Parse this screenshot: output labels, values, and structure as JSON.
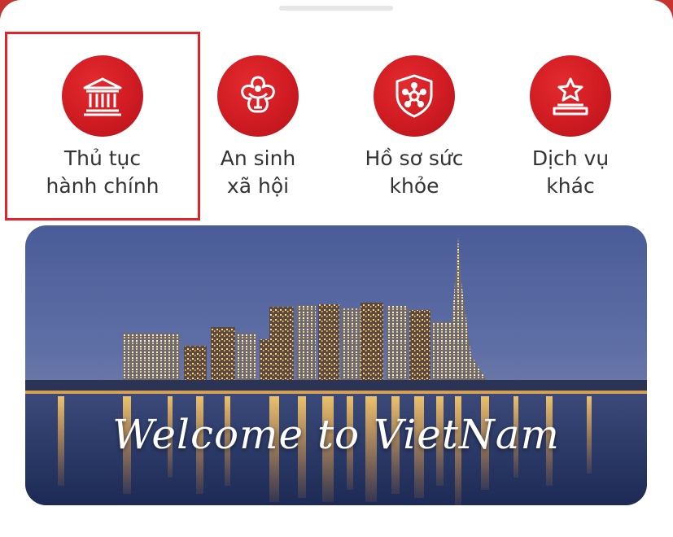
{
  "colors": {
    "brand": "#cf1b22",
    "selection": "#e2232a",
    "label": "#333333"
  },
  "services": [
    {
      "name": "administrative-procedures",
      "icon": "government-building-icon",
      "line1": "Thủ tục",
      "line2": "hành chính",
      "selected": true
    },
    {
      "name": "social-security",
      "icon": "family-flower-icon",
      "line1": "An sinh",
      "line2": "xã hội",
      "selected": false
    },
    {
      "name": "health-records",
      "icon": "health-shield-icon",
      "line1": "Hồ sơ sức",
      "line2": "khỏe",
      "selected": false
    },
    {
      "name": "other-services",
      "icon": "star-podium-icon",
      "line1": "Dịch vụ",
      "line2": "khác",
      "selected": false
    }
  ],
  "banner": {
    "caption": "Welcome to VietNam"
  }
}
